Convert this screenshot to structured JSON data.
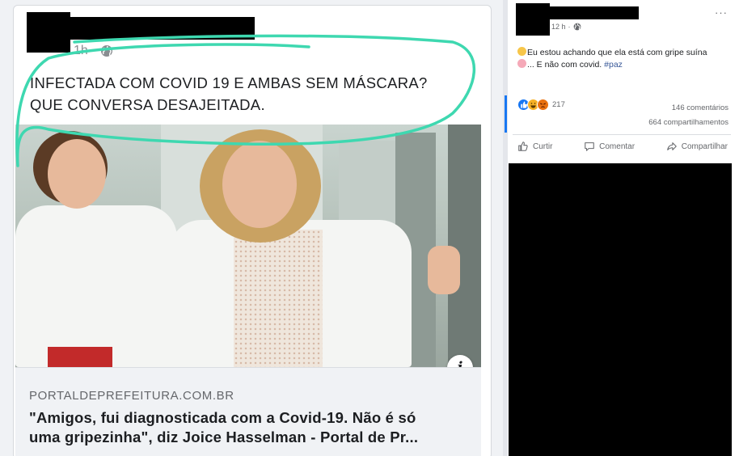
{
  "shared_post": {
    "time": "1h",
    "headline_line1": "INFECTADA COM COVID 19 E AMBAS SEM MÁSCARA?",
    "headline_line2": "QUE CONVERSA DESAJEITADA.",
    "link": {
      "domain": "PORTALDEPREFEITURA.COM.BR",
      "title_line1": "\"Amigos, fui diagnosticada com a Covid-19. Não é só",
      "title_line2": "uma gripezinha\", diz Joice Hasselman - Portal de Pr..."
    },
    "info_button": "i",
    "annotation_color": "#3ed8b0"
  },
  "post": {
    "time": "12 h",
    "caption_text_1": "Eu estou achando que ela está com gripe suína",
    "caption_text_2": "... E não com covid. ",
    "hashtag": "#paz",
    "reactions_count": "217",
    "comments": "146 comentários",
    "shares": "664 compartilhamentos",
    "actions": {
      "like": "Curtir",
      "comment": "Comentar",
      "share": "Compartilhar"
    },
    "more_icon": "···"
  },
  "colors": {
    "facebook_blue": "#1877f2",
    "meta_gray": "#65676b",
    "redaction": "#000000"
  }
}
